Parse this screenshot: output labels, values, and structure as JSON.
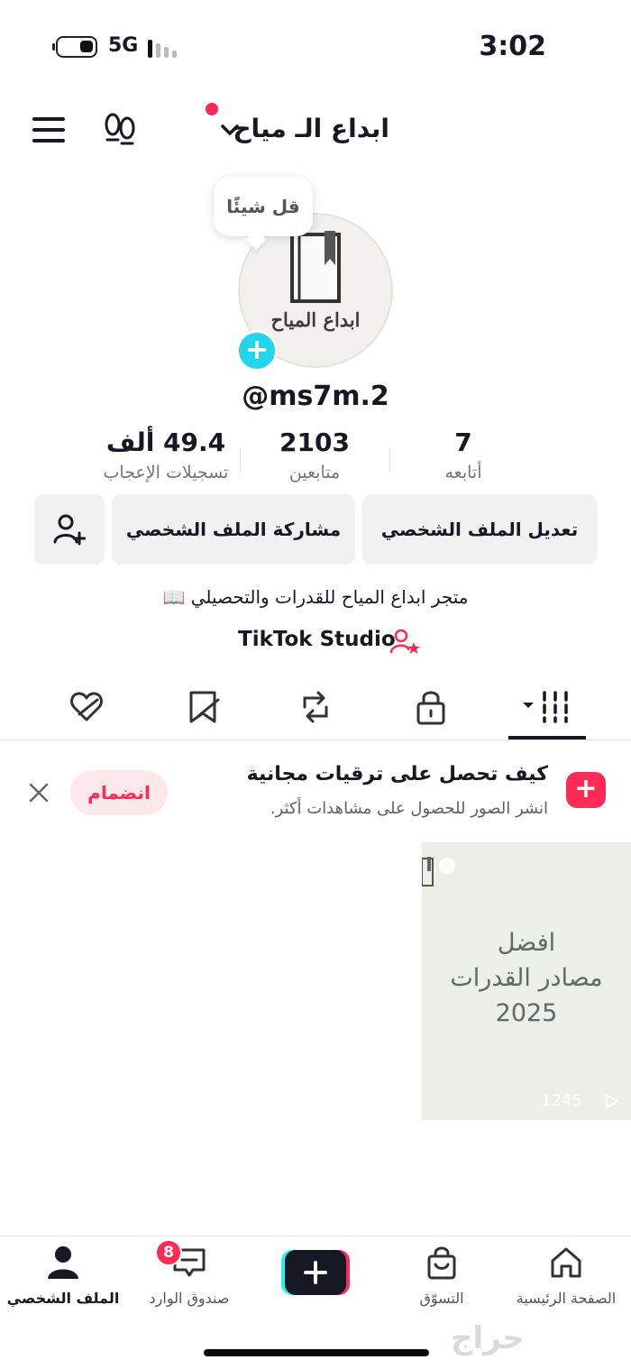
{
  "status_bar": {
    "network": "5G",
    "time": "3:02"
  },
  "header": {
    "title": "ابداع الـ مياح"
  },
  "profile": {
    "speech_bubble": "قل شيئًا",
    "avatar_text": "ابداع المياح",
    "handle": "@ms7m.2",
    "bio": "متجر ابداع المياح للقدرات والتحصيلي 📖",
    "studio_link": "TikTok Studio"
  },
  "stats": {
    "following": {
      "value": "7",
      "label": "أتابعه"
    },
    "followers": {
      "value": "2103",
      "label": "متابعين"
    },
    "likes": {
      "value": "49.4 ألف",
      "label": "تسجيلات الإعجاب"
    }
  },
  "buttons": {
    "edit_profile": "تعديل الملف الشخصي",
    "share_profile": "مشاركة الملف الشخصي"
  },
  "promo": {
    "title": "كيف تحصل على ترقيات مجانية",
    "subtitle": "انشر الصور للحصول على مشاهدات أكثر.",
    "join": "انضمام"
  },
  "video": {
    "line1": "افضل",
    "line2": "مصادر القدرات",
    "line3": "2025",
    "views": "1245"
  },
  "bottom_nav": {
    "home": "الصفحة الرئيسية",
    "shop": "التسوّق",
    "inbox": "صندوق الوارد",
    "inbox_badge": "8",
    "profile": "الملف الشخصي"
  },
  "watermark": "حراج"
}
